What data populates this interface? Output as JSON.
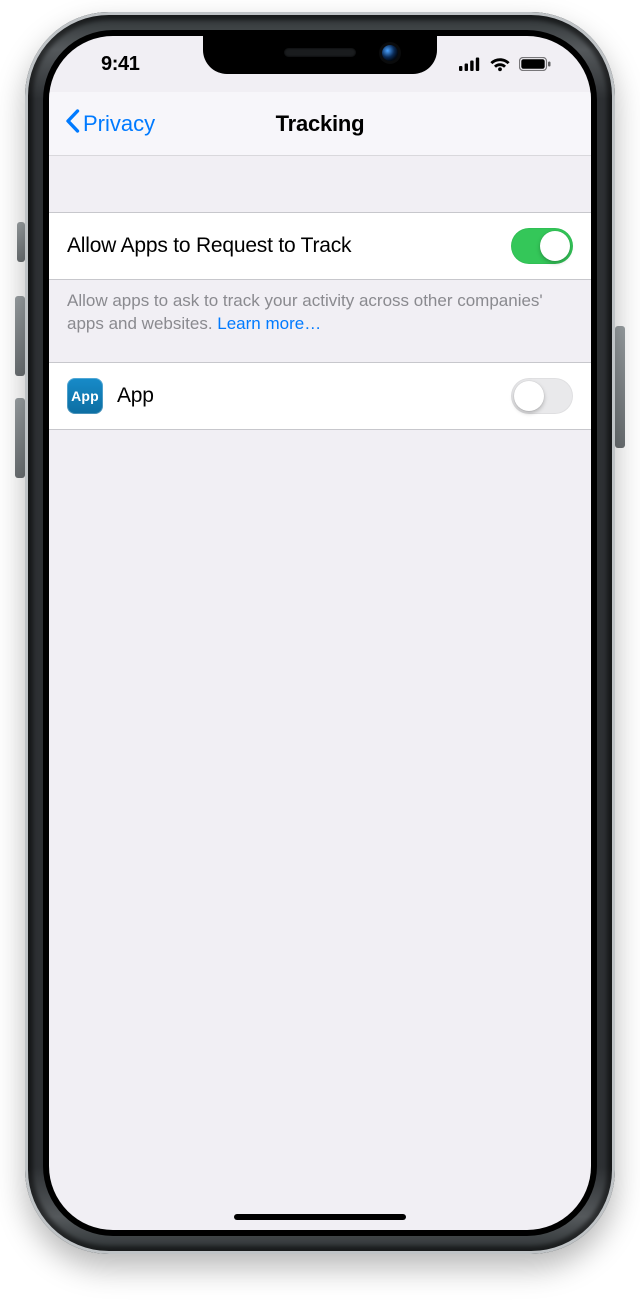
{
  "statusbar": {
    "time": "9:41"
  },
  "nav": {
    "back_label": "Privacy",
    "title": "Tracking"
  },
  "rows": {
    "allow": {
      "label": "Allow Apps to Request to Track",
      "toggle_on": true
    },
    "app": {
      "label": "App",
      "icon_text": "App",
      "toggle_on": false
    }
  },
  "footer": {
    "text": "Allow apps to ask to track your activity across other companies' apps and websites. ",
    "learn_more": "Learn more…"
  },
  "colors": {
    "accent": "#007aff",
    "toggle_on": "#34c759"
  }
}
